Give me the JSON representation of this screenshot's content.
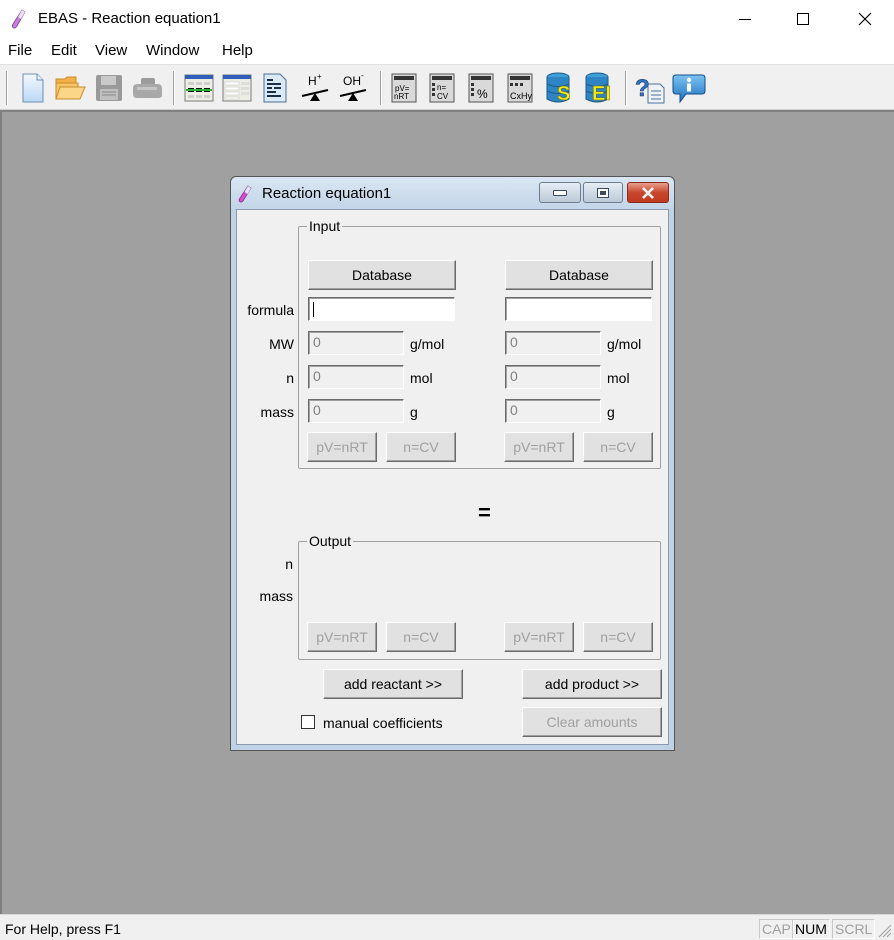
{
  "window": {
    "title": "EBAS - Reaction equation1",
    "controls": {
      "minimize": "minimize",
      "maximize": "maximize",
      "close": "close"
    }
  },
  "menu": {
    "items": [
      {
        "label": "File"
      },
      {
        "label": "Edit"
      },
      {
        "label": "View"
      },
      {
        "label": "Window"
      },
      {
        "label": "Help"
      }
    ]
  },
  "toolbar": {
    "buttons": [
      {
        "icon": "new-document-icon",
        "tooltip": "New"
      },
      {
        "icon": "open-folder-icon",
        "tooltip": "Open"
      },
      {
        "icon": "save-icon",
        "tooltip": "Save",
        "enabled": false
      },
      {
        "icon": "print-icon",
        "tooltip": "Print",
        "enabled": false
      },
      {
        "icon": "reaction-equation-icon"
      },
      {
        "icon": "table-icon"
      },
      {
        "icon": "report-icon"
      },
      {
        "icon": "acid-balance-icon",
        "glyph": "H+"
      },
      {
        "icon": "base-balance-icon",
        "glyph": "OH-"
      },
      {
        "icon": "calc-pv-nrt-icon",
        "glyph": "pV= nRT"
      },
      {
        "icon": "calc-n-cv-icon",
        "glyph": "n= CV"
      },
      {
        "icon": "calc-percent-icon",
        "glyph": "%"
      },
      {
        "icon": "calc-cxhy-icon",
        "glyph": "CxHy"
      },
      {
        "icon": "database-s-icon",
        "glyph": "S"
      },
      {
        "icon": "database-ei-icon",
        "glyph": "EI"
      },
      {
        "icon": "help-icon",
        "glyph": "?"
      },
      {
        "icon": "info-icon",
        "glyph": "i"
      }
    ]
  },
  "child_window": {
    "title": "Reaction equation1",
    "input_group": {
      "label": "Input",
      "row_labels": {
        "formula": "formula",
        "mw": "MW",
        "n": "n",
        "mass": "mass"
      },
      "columns": [
        {
          "database_label": "Database",
          "formula": "",
          "mw": "0",
          "mw_unit": "g/mol",
          "n": "0",
          "n_unit": "mol",
          "mass": "0",
          "mass_unit": "g",
          "pv_label": "pV=nRT",
          "cv_label": "n=CV"
        },
        {
          "database_label": "Database",
          "formula": "",
          "mw": "0",
          "mw_unit": "g/mol",
          "n": "0",
          "n_unit": "mol",
          "mass": "0",
          "mass_unit": "g",
          "pv_label": "pV=nRT",
          "cv_label": "n=CV"
        }
      ]
    },
    "equals_sign": "=",
    "output_group": {
      "label": "Output",
      "row_labels": {
        "n": "n",
        "mass": "mass"
      },
      "columns": [
        {
          "pv_label": "pV=nRT",
          "cv_label": "n=CV"
        },
        {
          "pv_label": "pV=nRT",
          "cv_label": "n=CV"
        }
      ]
    },
    "add_reactant_label": "add reactant >>",
    "add_product_label": "add product >>",
    "manual_coefficients_label": "manual coefficients",
    "manual_coefficients_checked": false,
    "clear_amounts_label": "Clear amounts"
  },
  "statusbar": {
    "text": "For Help, press F1",
    "indicators": [
      {
        "label": "CAP",
        "active": false
      },
      {
        "label": "NUM",
        "active": true
      },
      {
        "label": "SCRL",
        "active": false
      }
    ]
  },
  "colors": {
    "mdi_background": "#a0a0a0",
    "dialog_background": "#f0f0f0",
    "close_button": "#c9462c",
    "disabled_text": "#a0a0a0"
  }
}
